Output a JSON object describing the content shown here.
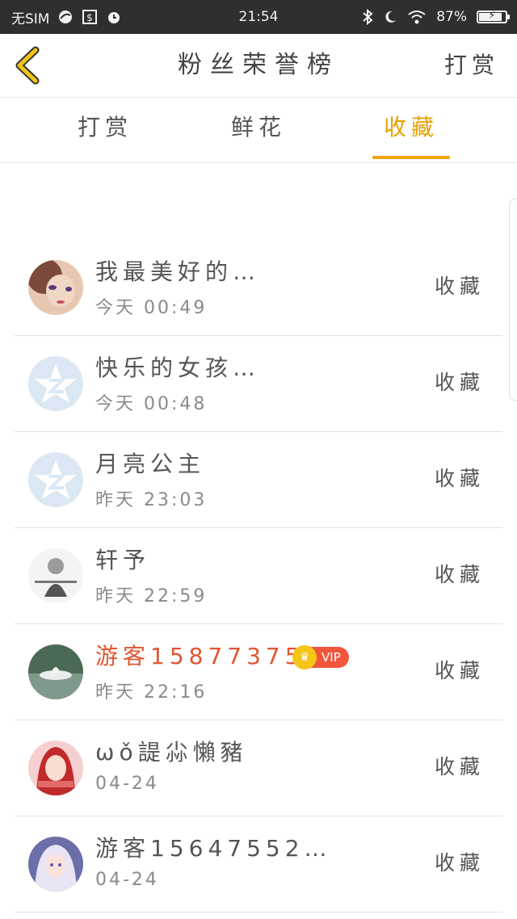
{
  "status_bar": {
    "sim": "无SIM",
    "time": "21:54",
    "battery": "87%",
    "battery_level": 0.87
  },
  "header": {
    "title": "粉丝荣誉榜",
    "action": "打赏"
  },
  "tabs": [
    {
      "label": "打赏",
      "active": false
    },
    {
      "label": "鲜花",
      "active": false
    },
    {
      "label": "收藏",
      "active": true
    }
  ],
  "list": [
    {
      "name": "我最美好的…",
      "time": "今天 00:49",
      "action": "收藏"
    },
    {
      "name": "快乐的女孩…",
      "time": "今天 00:48",
      "action": "收藏"
    },
    {
      "name": "月亮公主",
      "time": "昨天 23:03",
      "action": "收藏"
    },
    {
      "name": "轩予",
      "time": "昨天 22:59",
      "action": "收藏"
    },
    {
      "name": "游客15877375…",
      "time": "昨天 22:16",
      "action": "收藏",
      "vip": "VIP"
    },
    {
      "name": "ωǒ諟尛懶豬",
      "time": "04-24",
      "action": "收藏"
    },
    {
      "name": "游客15647552…",
      "time": "04-24",
      "action": "收藏"
    }
  ],
  "colors": {
    "accent": "#f0a500",
    "vip": "#f0563c",
    "status_bar": "#2f2f2f"
  }
}
